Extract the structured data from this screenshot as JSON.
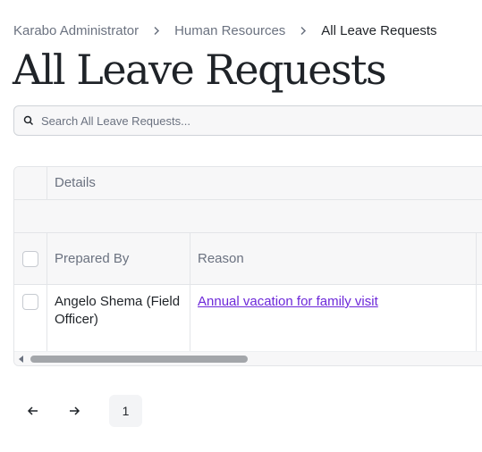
{
  "breadcrumb": {
    "items": [
      "Karabo Administrator",
      "Human Resources"
    ],
    "current": "All Leave Requests"
  },
  "page": {
    "title": "All Leave Requests"
  },
  "search": {
    "placeholder": "Search All Leave Requests..."
  },
  "table": {
    "group_header": "Details",
    "columns": [
      "Prepared By",
      "Reason"
    ],
    "rows": [
      {
        "prepared_by": "Angelo Shema (Field Officer)",
        "reason": "Annual vacation for family visit"
      }
    ]
  },
  "pagination": {
    "current_page": "1"
  },
  "colors": {
    "link": "#6d28d9",
    "muted": "#6b7280",
    "border": "#e3e5e8",
    "header_bg": "#f7f7f8"
  },
  "icons": [
    "chevron-right-icon",
    "search-icon",
    "arrow-left-icon",
    "arrow-right-icon",
    "scroll-left-icon"
  ]
}
